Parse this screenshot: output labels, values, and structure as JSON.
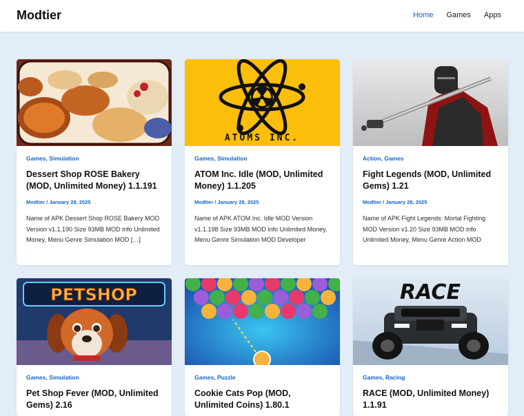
{
  "site": {
    "logo": "Modtier",
    "nav": [
      "Home",
      "Games",
      "Apps"
    ]
  },
  "posts": [
    {
      "categories": [
        "Games",
        "Simulation"
      ],
      "title": "Dessert Shop ROSE Bakery (MOD, Unlimited Money) 1.1.191",
      "author": "Modtier",
      "date": "January 28, 2025",
      "excerpt": "Name of APK Dessert Shop ROSE Bakery MOD Version v1.1.190 Size 93MB MOD info Unlimited Money, Menu Genre Simulation MOD […]"
    },
    {
      "categories": [
        "Games",
        "Simulation"
      ],
      "title": "ATOM Inc. Idle (MOD, Unlimited Money) 1.1.205",
      "author": "Modtier",
      "date": "January 28, 2025",
      "excerpt": "Name of APK ATOM Inc. Idle MOD Version v1.1.198 Size 93MB MOD info Unlimited Money, Menu Genre Simulation MOD Developer",
      "image_text": "ATOMS INC."
    },
    {
      "categories": [
        "Action",
        "Games"
      ],
      "title": "Fight Legends (MOD, Unlimited Gems) 1.21",
      "author": "Modtier",
      "date": "January 28, 2025",
      "excerpt": "Name of APK Fight Legends: Mortal Fighting MOD Version v1.20 Size 93MB MOD info Unlimited Money, Menu Genre Action MOD"
    },
    {
      "categories": [
        "Games",
        "Simulation"
      ],
      "title": "Pet Shop Fever (MOD, Unlimited Gems) 2.16",
      "image_text": "PETSHOP"
    },
    {
      "categories": [
        "Games",
        "Puzzle"
      ],
      "title": "Cookie Cats Pop (MOD, Unlimited Coins) 1.80.1"
    },
    {
      "categories": [
        "Games",
        "Racing"
      ],
      "title": "RACE (MOD, Unlimited Money) 1.1.91",
      "image_text": "RACE"
    }
  ]
}
